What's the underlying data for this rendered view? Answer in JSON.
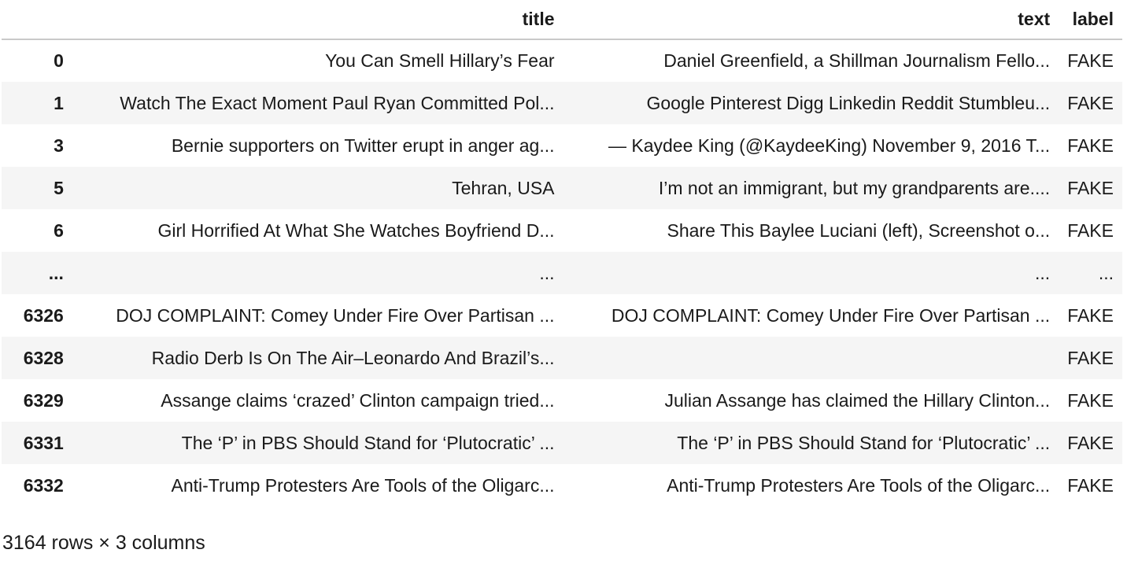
{
  "table": {
    "columns": [
      "",
      "title",
      "text",
      "label"
    ],
    "rows": [
      [
        "0",
        "You Can Smell Hillary’s Fear",
        "Daniel Greenfield, a Shillman Journalism Fello...",
        "FAKE"
      ],
      [
        "1",
        "Watch The Exact Moment Paul Ryan Committed Pol...",
        "Google Pinterest Digg Linkedin Reddit Stumbleu...",
        "FAKE"
      ],
      [
        "3",
        "Bernie supporters on Twitter erupt in anger ag...",
        "— Kaydee King (@KaydeeKing) November 9, 2016 T...",
        "FAKE"
      ],
      [
        "5",
        "Tehran, USA",
        "I’m not an immigrant, but my grandparents are....",
        "FAKE"
      ],
      [
        "6",
        "Girl Horrified At What She Watches Boyfriend D...",
        "Share This Baylee Luciani (left), Screenshot o...",
        "FAKE"
      ],
      [
        "...",
        "...",
        "...",
        "..."
      ],
      [
        "6326",
        "DOJ COMPLAINT: Comey Under Fire Over Partisan ...",
        "DOJ COMPLAINT: Comey Under Fire Over Partisan ...",
        "FAKE"
      ],
      [
        "6328",
        "Radio Derb Is On The Air–Leonardo And Brazil’s...",
        "",
        "FAKE"
      ],
      [
        "6329",
        "Assange claims ‘crazed’ Clinton campaign tried...",
        "Julian Assange has claimed the Hillary Clinton...",
        "FAKE"
      ],
      [
        "6331",
        "The ‘P’ in PBS Should Stand for ‘Plutocratic’ ...",
        "The ‘P’ in PBS Should Stand for ‘Plutocratic’ ...",
        "FAKE"
      ],
      [
        "6332",
        "Anti-Trump Protesters Are Tools of the Oligarc...",
        "Anti-Trump Protesters Are Tools of the Oligarc...",
        "FAKE"
      ]
    ]
  },
  "shape_text": "3164 rows × 3 columns"
}
